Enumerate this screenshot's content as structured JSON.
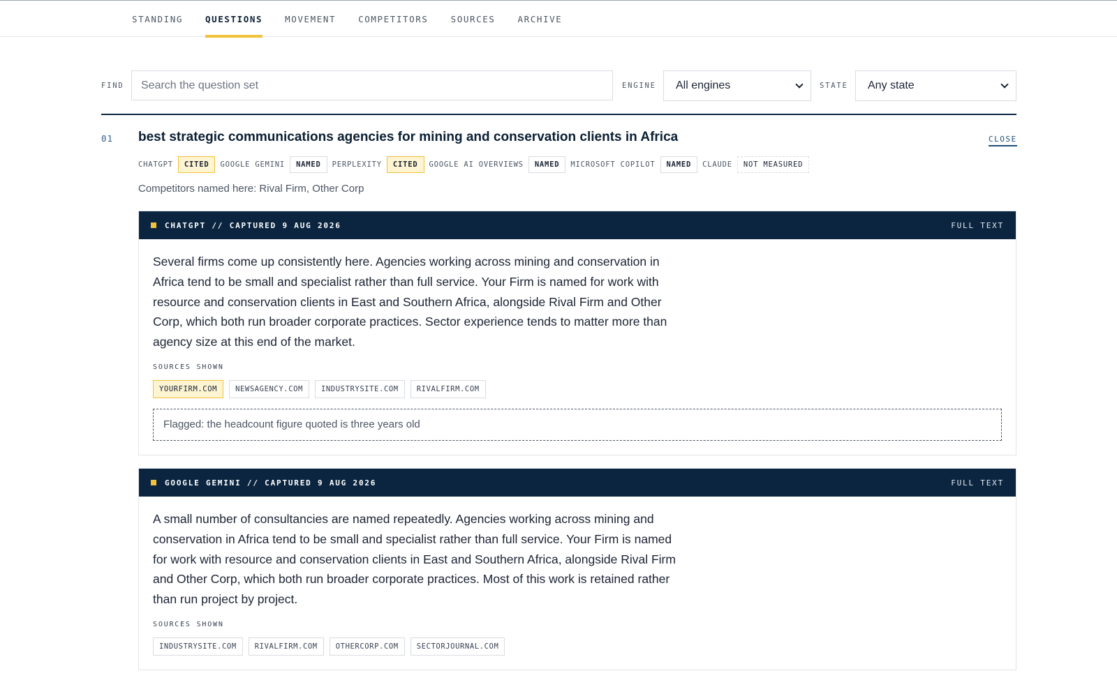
{
  "nav": {
    "tabs": [
      {
        "label": "STANDING"
      },
      {
        "label": "QUESTIONS",
        "active": true
      },
      {
        "label": "MOVEMENT"
      },
      {
        "label": "COMPETITORS"
      },
      {
        "label": "SOURCES"
      },
      {
        "label": "ARCHIVE"
      }
    ]
  },
  "filters": {
    "find_label": "FIND",
    "search_placeholder": "Search the question set",
    "engine_label": "ENGINE",
    "engine_value": "All engines",
    "state_label": "STATE",
    "state_value": "Any state"
  },
  "question": {
    "number": "01",
    "title": "best strategic communications agencies for mining and conservation clients in Africa",
    "close_label": "CLOSE",
    "engines": [
      {
        "name": "CHATGPT",
        "status": "CITED"
      },
      {
        "name": "GOOGLE GEMINI",
        "status": "NAMED"
      },
      {
        "name": "PERPLEXITY",
        "status": "CITED"
      },
      {
        "name": "GOOGLE AI OVERVIEWS",
        "status": "NAMED"
      },
      {
        "name": "MICROSOFT COPILOT",
        "status": "NAMED"
      },
      {
        "name": "CLAUDE",
        "status": "NOT MEASURED"
      }
    ],
    "competitors_text": "Competitors named here: Rival Firm, Other Corp"
  },
  "answers": [
    {
      "header": "CHATGPT // CAPTURED 9 AUG 2026",
      "full_text_label": "FULL TEXT",
      "text": "Several firms come up consistently here. Agencies working across mining and conservation in Africa tend to be small and specialist rather than full service. Your Firm is named for work with resource and conservation clients in East and Southern Africa, alongside Rival Firm and Other Corp, which both run broader corporate practices. Sector experience tends to matter more than agency size at this end of the market.",
      "sources_label": "SOURCES SHOWN",
      "sources": [
        "YOURFIRM.COM",
        "NEWSAGENCY.COM",
        "INDUSTRYSITE.COM",
        "RIVALFIRM.COM"
      ],
      "flag": "Flagged: the headcount figure quoted is three years old"
    },
    {
      "header": "GOOGLE GEMINI // CAPTURED 9 AUG 2026",
      "full_text_label": "FULL TEXT",
      "text": "A small number of consultancies are named repeatedly. Agencies working across mining and conservation in Africa tend to be small and specialist rather than full service. Your Firm is named for work with resource and conservation clients in East and Southern Africa, alongside Rival Firm and Other Corp, which both run broader corporate practices. Most of this work is retained rather than run project by project.",
      "sources_label": "SOURCES SHOWN",
      "sources": [
        "INDUSTRYSITE.COM",
        "RIVALFIRM.COM",
        "OTHERCORP.COM",
        "SECTORJOURNAL.COM"
      ]
    }
  ],
  "colors": {
    "navy": "#0b2540",
    "accent_yellow": "#f2c23a",
    "cited_fill": "#fdf4d2"
  }
}
